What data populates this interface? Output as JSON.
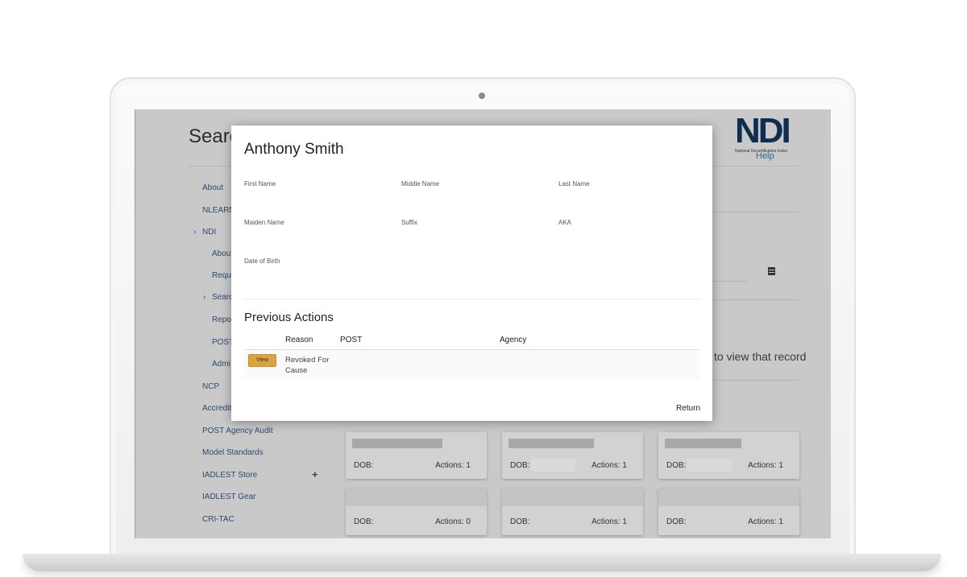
{
  "page": {
    "title": "Searc",
    "help_label": "Help",
    "logo": {
      "text": "NDI",
      "subtitle": "National Decertification Index"
    },
    "side_nav": [
      {
        "label": "About",
        "level": 0,
        "expandable": false
      },
      {
        "label": "NLEARN",
        "level": 0,
        "expandable": false
      },
      {
        "label": "NDI",
        "level": 0,
        "expandable": true
      },
      {
        "label": "About",
        "level": 1,
        "expandable": false
      },
      {
        "label": "Reque",
        "level": 1,
        "expandable": false
      },
      {
        "label": "Searc",
        "level": 1,
        "expandable": true
      },
      {
        "label": "Repor",
        "level": 1,
        "expandable": false
      },
      {
        "label": "POST",
        "level": 1,
        "expandable": false
      },
      {
        "label": "Admi",
        "level": 1,
        "expandable": false
      },
      {
        "label": "NCP",
        "level": 0,
        "expandable": false
      },
      {
        "label": "Accredit",
        "level": 0,
        "expandable": false
      },
      {
        "label": "POST Agency Audit",
        "level": 0,
        "expandable": false
      },
      {
        "label": "Model Standards",
        "level": 0,
        "expandable": false
      },
      {
        "label": "IADLEST Store",
        "level": 0,
        "expandable": false
      },
      {
        "label": "IADLEST Gear",
        "level": 0,
        "expandable": false
      },
      {
        "label": "CRI-TAC",
        "level": 0,
        "expandable": false
      }
    ],
    "partial_text": "to view that record",
    "result_cards": [
      {
        "dob_label": "DOB:",
        "actions_label": "Actions: 1"
      },
      {
        "dob_label": "DOB:",
        "actions_label": "Actions: 1"
      },
      {
        "dob_label": "DOB:",
        "actions_label": "Actions: 1"
      },
      {
        "dob_label": "DOB:",
        "actions_label": "Actions: 0"
      },
      {
        "dob_label": "DOB:",
        "actions_label": "Actions: 1"
      },
      {
        "dob_label": "DOB:",
        "actions_label": "Actions: 1"
      }
    ]
  },
  "modal": {
    "title": "Anthony Smith",
    "fields": {
      "first_name": "First Name",
      "middle_name": "Middle Name",
      "last_name": "Last Name",
      "maiden_name": "Maiden Name",
      "suffix": "Suffix",
      "aka": "AKA",
      "date_of_birth": "Date of Birth"
    },
    "previous_actions": {
      "title": "Previous Actions",
      "columns": [
        "Reason",
        "POST",
        "Agency"
      ],
      "rows": [
        {
          "button": "View",
          "reason": "Revoked For Cause",
          "post": "",
          "agency": ""
        }
      ]
    },
    "return_label": "Return"
  },
  "colors": {
    "view_button": "#d9a441",
    "overlay": "#c9c9c9",
    "nav_link": "#2c4a6e",
    "logo": "#0f2d4e"
  }
}
